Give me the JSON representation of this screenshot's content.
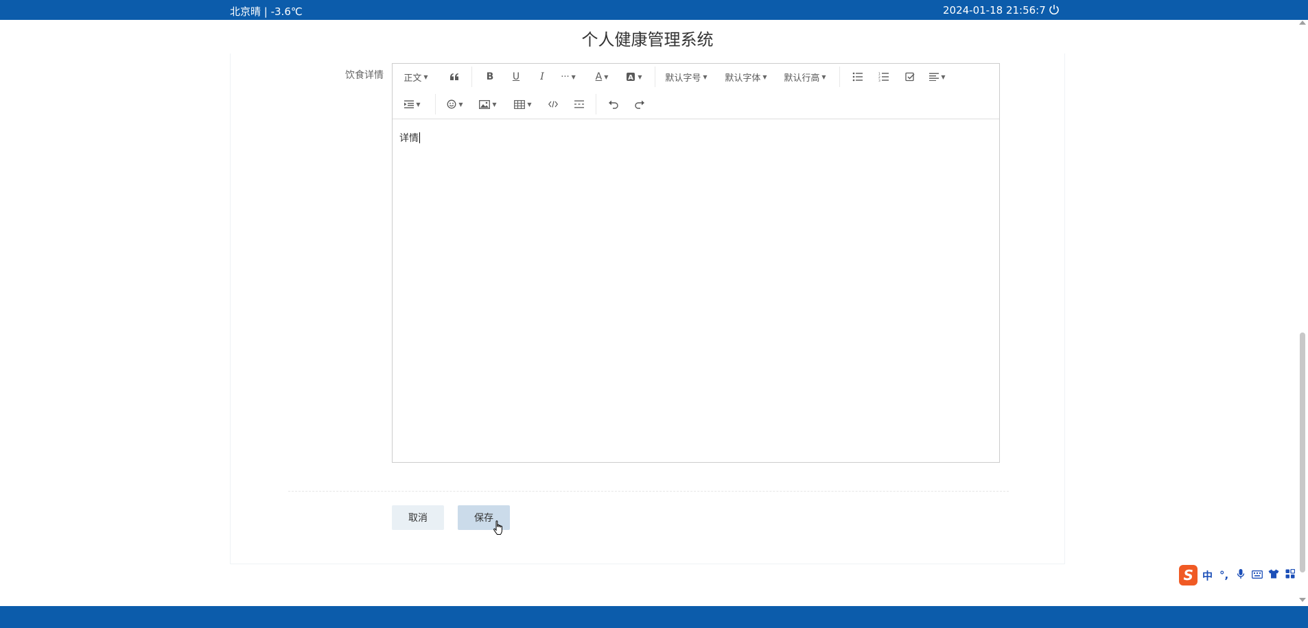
{
  "topbar": {
    "weather": "北京晴 | -3.6℃",
    "datetime": "2024-01-18  21:56:7",
    "power_icon": "power-icon"
  },
  "app": {
    "title": "个人健康管理系统"
  },
  "form": {
    "field_label": "饮食详情",
    "editor_content": "详情"
  },
  "toolbar": {
    "paragraph": "正文",
    "font_size": "默认字号",
    "font_family": "默认字体",
    "line_height": "默认行高",
    "more": "···"
  },
  "buttons": {
    "cancel": "取消",
    "save": "保存"
  },
  "ime": {
    "mode": "中",
    "punct": "°,"
  },
  "colors": {
    "brand": "#0c5cab",
    "save_bg": "#cbdbea",
    "cancel_bg": "#e9f0f5"
  }
}
